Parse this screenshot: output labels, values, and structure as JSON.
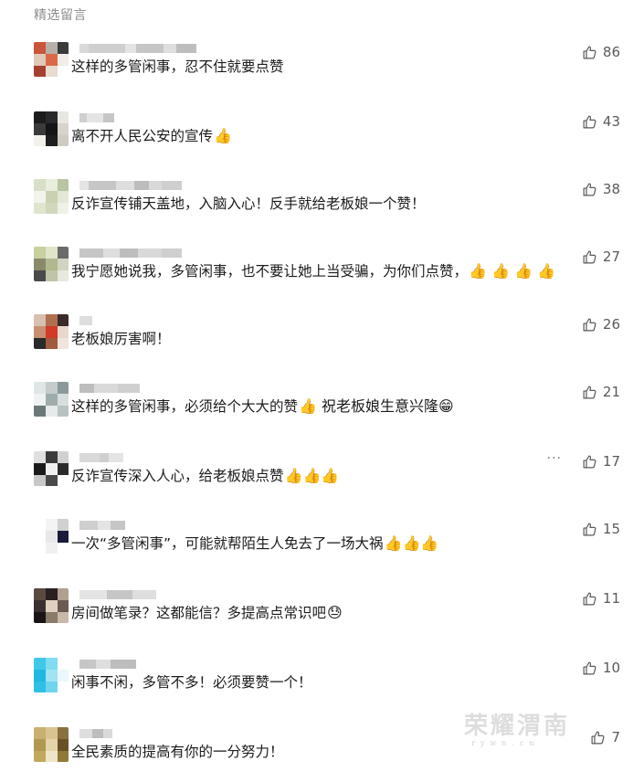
{
  "section_title": "精选留言",
  "comments": [
    {
      "text": "这样的多管闲事，忍不住就要点赞",
      "emoji": "",
      "likes": "86"
    },
    {
      "text": "离不开人民公安的宣传",
      "emoji": "👍",
      "likes": "43"
    },
    {
      "text": "反诈宣传铺天盖地，入脑入心！反手就给老板娘一个赞！",
      "emoji": "",
      "likes": "38"
    },
    {
      "text": "我宁愿她说我，多管闲事，也不要让她上当受骗，为你们点赞，",
      "emoji": "👍 👍 👍 👍",
      "likes": "27"
    },
    {
      "text": "老板娘厉害啊！",
      "emoji": "",
      "likes": "26"
    },
    {
      "text": "这样的多管闲事，必须给个大大的赞",
      "emoji": "👍 祝老板娘生意兴隆😁",
      "likes": "21"
    },
    {
      "text": "反诈宣传深入人心，给老板娘点赞",
      "emoji": "👍👍👍",
      "likes": "17"
    },
    {
      "text": "一次“多管闲事”，可能就帮陌生人免去了一场大祸",
      "emoji": "👍👍👍",
      "likes": "15"
    },
    {
      "text": "房间做笔录？这都能信？多提高点常识吧",
      "emoji": "😓",
      "likes": "11"
    },
    {
      "text": "闲事不闲，多管不多！必须要赞一个！",
      "emoji": "",
      "likes": "10"
    },
    {
      "text": "全民素质的提高有你的一分努力！",
      "emoji": "",
      "likes": "7"
    }
  ],
  "more_label": "···",
  "watermark": {
    "main": "荣耀渭南",
    "sub": "rywn.cn"
  },
  "colors": {
    "like_icon": "#5a5a5a",
    "text": "#1b1b1b",
    "muted": "#8c8c8c"
  }
}
